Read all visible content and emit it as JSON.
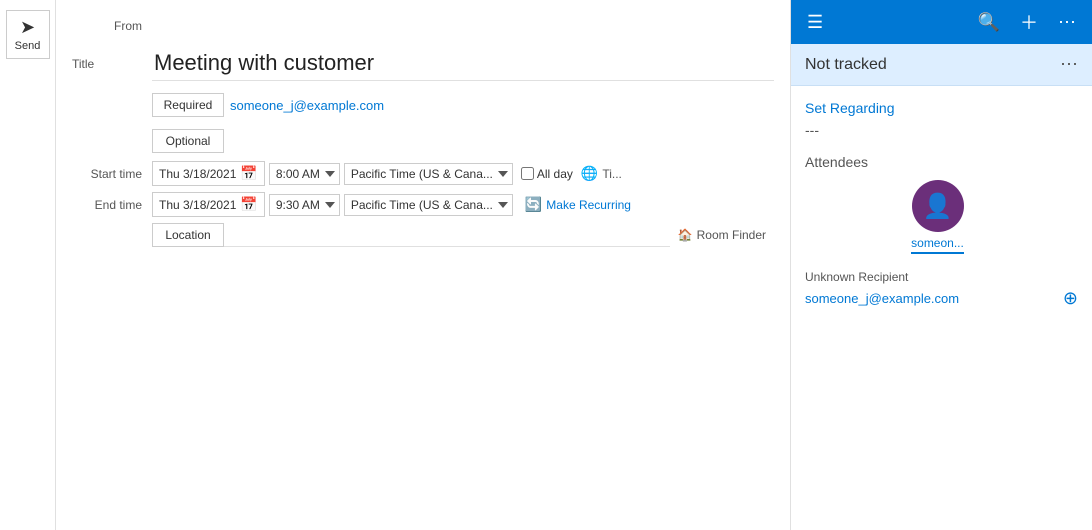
{
  "send_panel": {
    "send_label": "Send",
    "send_arrow": "➤"
  },
  "compose": {
    "from_label": "From",
    "title_label": "Title",
    "title_value": "Meeting with customer",
    "title_placeholder": "Meeting with customer",
    "required_label": "Required",
    "optional_label": "Optional",
    "required_email": "someone_j@example.com",
    "optional_email": "",
    "start_time_label": "Start time",
    "end_time_label": "End time",
    "start_date": "Thu 3/18/2021",
    "end_date": "Thu 3/18/2021",
    "start_time": "8:00 AM",
    "end_time": "9:30 AM",
    "timezone": "Pacific Time (US & Cana...",
    "all_day_label": "All day",
    "teams_label": "Ti...",
    "recurring_label": "Make Recurring",
    "location_label": "Location",
    "location_placeholder": "",
    "room_finder_label": "Room Finder"
  },
  "right_panel": {
    "not_tracked_label": "Not tracked",
    "set_regarding_label": "Set Regarding",
    "regarding_dashes": "---",
    "attendees_label": "Attendees",
    "attendee_name": "someon...",
    "unknown_recipient_label": "Unknown Recipient",
    "recipient_email": "someone_j@example.com"
  }
}
